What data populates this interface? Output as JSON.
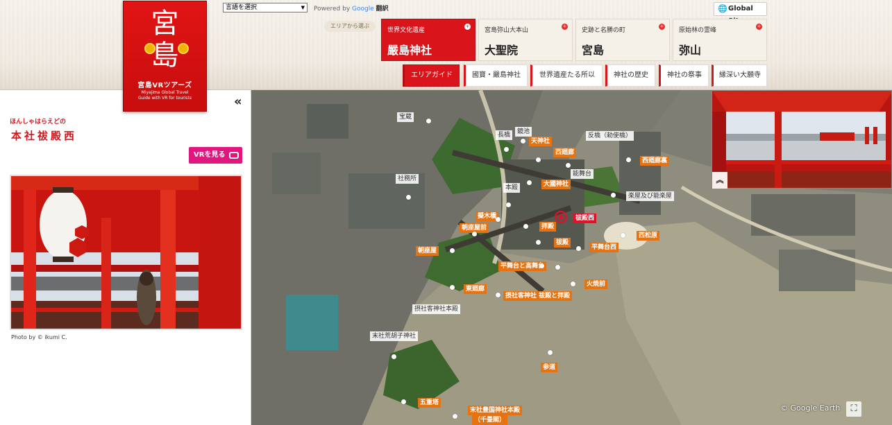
{
  "header": {
    "logo": {
      "kanji_1": "宮",
      "kanji_2": "島",
      "brand": "宮島VRツアーズ",
      "subtitle_1": "Miyajima Global Travel",
      "subtitle_2": "Guide with VR for tourists"
    },
    "language_select": "言語を選択",
    "powered_by": "Powered by",
    "google": "Google",
    "translate": "翻訳",
    "global_site": "Global Site",
    "area_label": "エリアから選ぶ",
    "area_tabs": [
      {
        "sub": "世界文化遺産",
        "main": "嚴島神社"
      },
      {
        "sub": "宮島弥山大本山",
        "main": "大聖院"
      },
      {
        "sub": "史跡と名勝の町",
        "main": "宮島"
      },
      {
        "sub": "原始林の霊峰",
        "main": "弥山"
      }
    ],
    "sub_tabs": [
      "エリアガイド",
      "國寶・嚴島神社",
      "世界遺産たる所以",
      "神社の歴史",
      "神社の祭事",
      "縁深い大願寺"
    ]
  },
  "panel": {
    "furigana": "ほんしゃはらえどの",
    "title": "本社祓殿西",
    "vr_button": "VRを見る",
    "photo_credit": "Photo by © ikumi C."
  },
  "map": {
    "labels": {
      "houmotsu": "宝蔵",
      "nagahashi": "長橋",
      "kagami": "鏡池",
      "tenjin": "天神社",
      "sorihashi": "反橋（勅使橋）",
      "nishikairo": "西廻廊",
      "nishikairo_ura": "西廻廊裏",
      "noubutai": "能舞台",
      "shabousho": "社務所",
      "honden": "本殿",
      "daikoku": "大國神社",
      "gakuya": "楽屋及び能楽屋",
      "haraidono_nishi": "祓殿西",
      "shukuba": "朝座屋",
      "ushi": "擬木橋",
      "asazaya_front": "朝座屋前",
      "haiden": "拝殿",
      "nishimatsubara": "西松原",
      "haraidono": "祓殿",
      "hirabutai_nishi": "平舞台西",
      "asazaya": "朝座屋",
      "hirabutai": "平舞台と高舞台",
      "hitakisaki": "火焼前",
      "higashikairo": "東廻廊",
      "setsumarodo": "摂社客神社 祓殿と拝殿",
      "setsumaro_honden": "摂社客神社本殿",
      "arebashi": "末社荒胡子神社",
      "sando": "参道",
      "gojunoto": "五重塔",
      "hokoku": "末社豊国神社本殿",
      "senjokaku": "（千畳閣）"
    },
    "google_earth": "Google Earth",
    "attribution_symbol": "©"
  },
  "icons": {
    "collapse": "«",
    "preview_up": "︽",
    "fullscreen": "⛶",
    "globe": "🌐",
    "caret": "▼",
    "plus": "+"
  },
  "colors": {
    "brand_red": "#d9151b",
    "vr_pink": "#e0177e",
    "label_orange": "#e67312"
  }
}
